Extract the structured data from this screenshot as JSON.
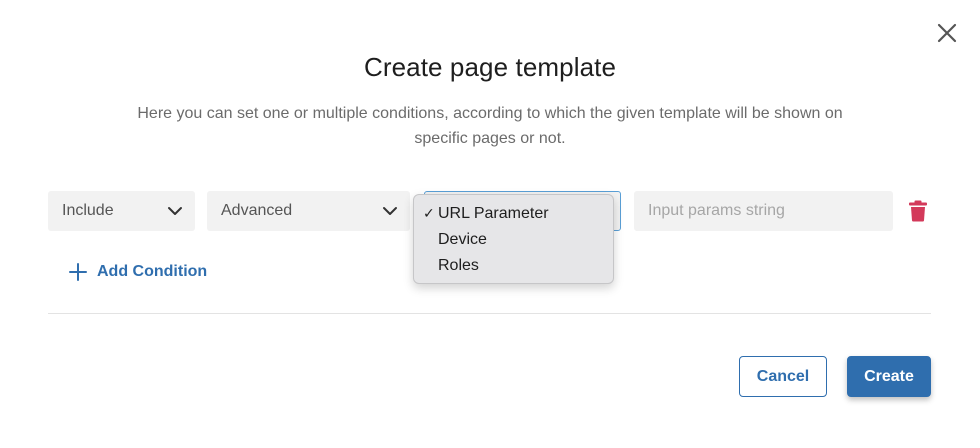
{
  "dialog": {
    "title": "Create page template",
    "description": "Here you can set one or multiple conditions, according to which the given template will be shown on specific pages or not."
  },
  "condition": {
    "include_select": "Include",
    "type_select": "Advanced",
    "param_select": "",
    "input_placeholder": "Input params string",
    "input_value": ""
  },
  "dropdown": {
    "options": [
      {
        "label": "URL Parameter",
        "selected": true
      },
      {
        "label": "Device",
        "selected": false
      },
      {
        "label": "Roles",
        "selected": false
      }
    ],
    "check_mark": "✓"
  },
  "actions": {
    "add_condition": "Add Condition",
    "cancel": "Cancel",
    "create": "Create"
  },
  "colors": {
    "accent": "#2f6eae",
    "delete": "#d3395a",
    "focus_border": "#5a9fd6"
  },
  "icons": {
    "close": "close-icon",
    "chevron": "chevron-down-icon",
    "trash": "trash-icon",
    "plus": "plus-icon"
  }
}
